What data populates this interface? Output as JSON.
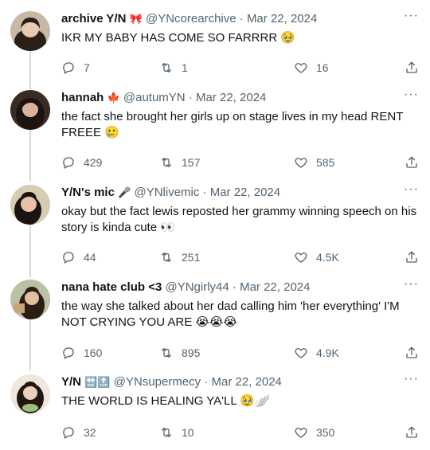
{
  "tweets": [
    {
      "name": "archive Y/N",
      "name_emoji": "🎀",
      "handle": "@YNcorearchive",
      "sep": "·",
      "date": "Mar 22, 2024",
      "text": "IKR MY BABY HAS COME SO FARRRR 🥹",
      "replies": "7",
      "retweets": "1",
      "likes": "16",
      "avatar_colors": {
        "bg": "#c9b8a6",
        "face": "#e8c9b2",
        "hair": "#2a2018"
      }
    },
    {
      "name": "hannah",
      "name_emoji": "🍁",
      "handle": "@autumYN",
      "sep": "·",
      "date": "Mar 22, 2024",
      "text": "the fact she brought her girls up on stage lives in my head RENT FREEE 🥲",
      "replies": "429",
      "retweets": "157",
      "likes": "585",
      "avatar_colors": {
        "bg": "#3a2c25",
        "face": "#d9b49a",
        "hair": "#1c1410"
      }
    },
    {
      "name": "Y/N's mic",
      "name_emoji": "🎤",
      "handle": "@YNlivemic",
      "sep": "·",
      "date": "Mar 22, 2024",
      "text": "okay but the fact lewis reposted her grammy winning speech on his story is kinda cute 👀",
      "replies": "44",
      "retweets": "251",
      "likes": "4.5K",
      "avatar_colors": {
        "bg": "#d8cbb6",
        "face": "#e6c3a6",
        "hair": "#1a1310"
      }
    },
    {
      "name": "nana hate club <3",
      "name_emoji": "",
      "handle": "@YNgirly44",
      "sep": "·",
      "date": "Mar 22, 2024",
      "text": "the way she talked about her dad calling him 'her everything' I'M NOT CRYING YOU ARE 😭😭😭",
      "replies": "160",
      "retweets": "895",
      "likes": "4.9K",
      "avatar_colors": {
        "bg": "#b9c2a4",
        "face": "#e3bfa2",
        "hair": "#2b1d14"
      }
    },
    {
      "name": "Y/N",
      "name_emoji": "🔛🔝",
      "handle": "@YNsupermecy",
      "sep": "·",
      "date": "Mar 22, 2024",
      "text": "THE WORLD IS HEALING YA'LL 🥹🪽",
      "replies": "32",
      "retweets": "10",
      "likes": "350",
      "avatar_colors": {
        "bg": "#f0e6dc",
        "face": "#ead0bb",
        "hair": "#201712"
      }
    }
  ],
  "more_glyph": "···",
  "colors": {
    "text": "#0f1419",
    "muted": "#536471",
    "line": "#cfd9de"
  }
}
